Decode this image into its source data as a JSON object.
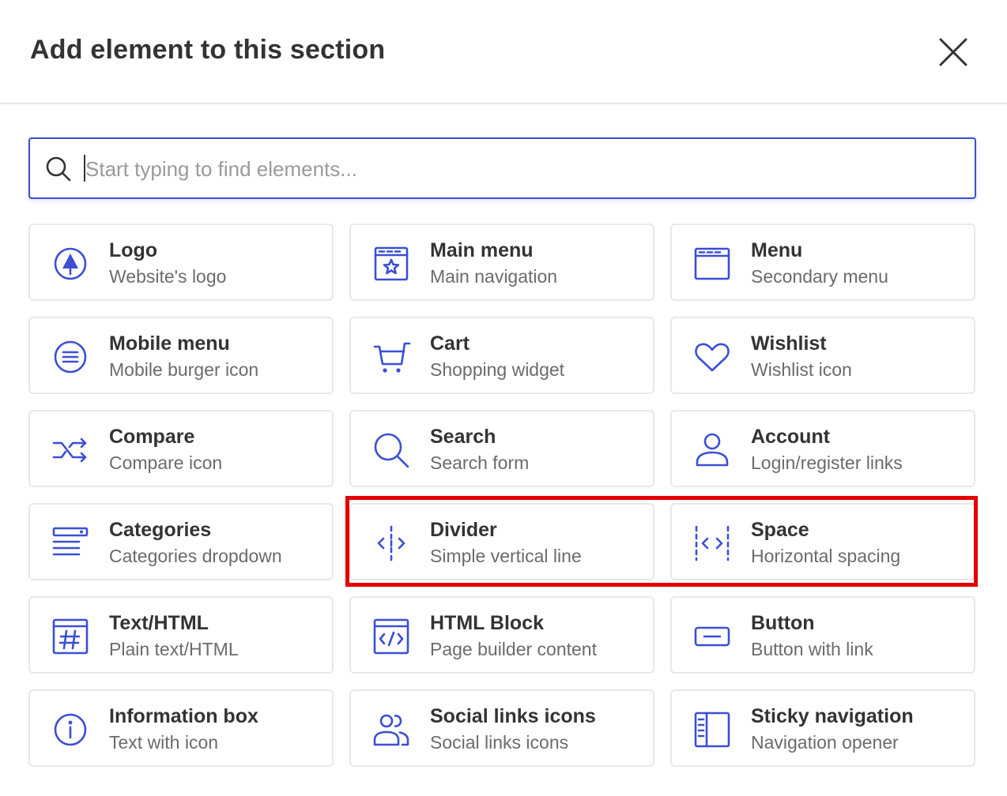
{
  "dialog": {
    "title": "Add element to this section",
    "close_icon": "close-icon"
  },
  "search": {
    "placeholder": "Start typing to find elements...",
    "value": "",
    "icon": "search-icon"
  },
  "colors": {
    "accent": "#3b4fd4",
    "highlight": "#e00000",
    "text": "#333333",
    "subtext": "#6b6b6b",
    "border": "#e8e8e8"
  },
  "elements": [
    {
      "title": "Logo",
      "subtitle": "Website's logo",
      "icon": "logo-icon"
    },
    {
      "title": "Main menu",
      "subtitle": "Main navigation",
      "icon": "main-menu-icon"
    },
    {
      "title": "Menu",
      "subtitle": "Secondary menu",
      "icon": "menu-window-icon"
    },
    {
      "title": "Mobile menu",
      "subtitle": "Mobile burger icon",
      "icon": "burger-icon"
    },
    {
      "title": "Cart",
      "subtitle": "Shopping widget",
      "icon": "cart-icon"
    },
    {
      "title": "Wishlist",
      "subtitle": "Wishlist icon",
      "icon": "heart-icon"
    },
    {
      "title": "Compare",
      "subtitle": "Compare icon",
      "icon": "shuffle-icon"
    },
    {
      "title": "Search",
      "subtitle": "Search form",
      "icon": "search-icon"
    },
    {
      "title": "Account",
      "subtitle": "Login/register links",
      "icon": "user-icon"
    },
    {
      "title": "Categories",
      "subtitle": "Categories dropdown",
      "icon": "categories-icon"
    },
    {
      "title": "Divider",
      "subtitle": "Simple vertical line",
      "icon": "divider-icon"
    },
    {
      "title": "Space",
      "subtitle": "Horizontal spacing",
      "icon": "space-icon"
    },
    {
      "title": "Text/HTML",
      "subtitle": "Plain text/HTML",
      "icon": "hashtag-icon"
    },
    {
      "title": "HTML Block",
      "subtitle": "Page builder content",
      "icon": "code-window-icon"
    },
    {
      "title": "Button",
      "subtitle": "Button with link",
      "icon": "button-icon"
    },
    {
      "title": "Information box",
      "subtitle": "Text with icon",
      "icon": "info-icon"
    },
    {
      "title": "Social links icons",
      "subtitle": "Social links icons",
      "icon": "users-icon"
    },
    {
      "title": "Sticky navigation",
      "subtitle": "Navigation opener",
      "icon": "sidebar-icon"
    }
  ]
}
